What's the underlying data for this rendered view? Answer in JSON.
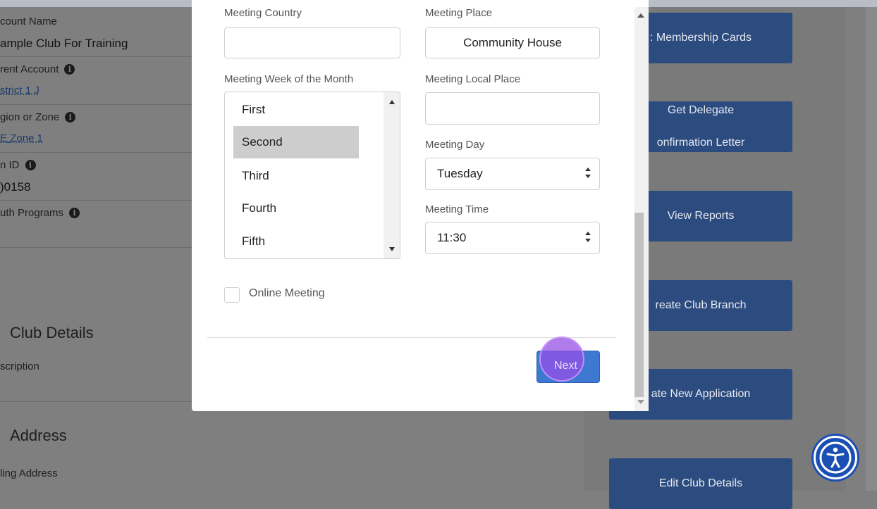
{
  "account": {
    "name_label": "count Name",
    "name_value": "ample Club For Training",
    "parent_label": "rent Account",
    "parent_value": "strict 1 J",
    "region_label": "gion or Zone",
    "region_value": "Zone 1",
    "region_prefix": "E",
    "id_label": "n ID",
    "id_value": ")0158",
    "youth_label": "uth Programs"
  },
  "sections": {
    "club_details": "Club Details",
    "description_label": "scription",
    "address": "Address",
    "mailing_label": "ling Address"
  },
  "right_buttons": [
    {
      "label": ": Membership Cards"
    },
    {
      "label_line1": "Get Delegate",
      "label_line2": "onfirmation Letter"
    },
    {
      "label": "View Reports"
    },
    {
      "label": "reate Club Branch"
    },
    {
      "label": "ate New Application"
    },
    {
      "label": "Edit Club Details"
    }
  ],
  "modal": {
    "country_label": "Meeting Country",
    "country_value": "",
    "place_label": "Meeting Place",
    "place_value": "Community House",
    "week_label": "Meeting Week of the Month",
    "week_options": [
      "First",
      "Second",
      "Third",
      "Fourth",
      "Fifth"
    ],
    "week_selected": "Second",
    "local_place_label": "Meeting Local Place",
    "local_place_value": "",
    "day_label": "Meeting Day",
    "day_value": "Tuesday",
    "time_label": "Meeting Time",
    "time_value": "11:30",
    "online_label": "Online Meeting",
    "online_checked": false,
    "next_label": "Next"
  },
  "colors": {
    "primary": "#2c4b7e",
    "next_button": "#3d79d0",
    "click_indicator": "#9650e6",
    "accessibility": "#1b4fb3"
  },
  "icons": {
    "info": "info-icon",
    "accessibility": "accessibility-icon"
  }
}
